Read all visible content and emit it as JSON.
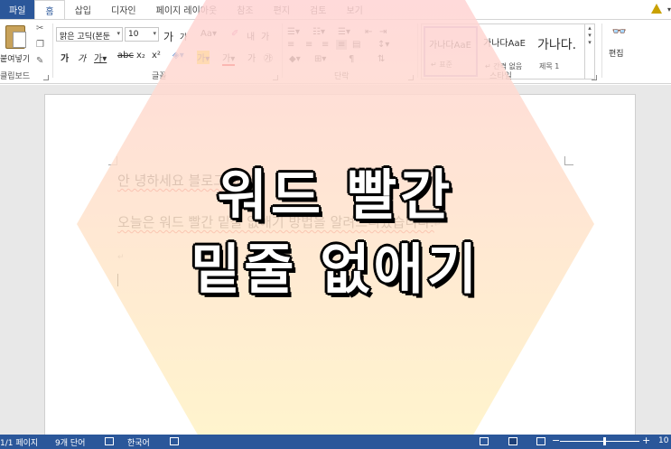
{
  "tabs": [
    {
      "label": "파일"
    },
    {
      "label": "홈"
    },
    {
      "label": "삽입"
    },
    {
      "label": "디자인"
    },
    {
      "label": "페이지 레이아웃"
    },
    {
      "label": "참조"
    },
    {
      "label": "편지"
    },
    {
      "label": "검토"
    },
    {
      "label": "보기"
    }
  ],
  "ribbon": {
    "clipboard": {
      "paste_label": "붙여넣기",
      "group_label": "클립보드"
    },
    "font": {
      "font_name": "맑은 고딕(본둔",
      "font_size": "10",
      "group_label": "글꼴"
    },
    "paragraph": {
      "group_label": "단락"
    },
    "styles": {
      "group_label": "스타일",
      "cards": [
        {
          "sample": "가나다AaE",
          "name": "↵ 표준"
        },
        {
          "sample": "가나다AaE",
          "name": "↵ 간격 없음"
        },
        {
          "sample": "가나다.",
          "name": "제목 1"
        }
      ]
    },
    "editing": {
      "label": "편집"
    }
  },
  "document": {
    "line1": "안 녕하세요 블로그 에요",
    "line2": "오늘은 워드 빨간 밑줄 없애기 방법을 알려드리겠습니다."
  },
  "overlay": {
    "title_line1": "워드 빨간",
    "title_line2": "밑줄 없애기",
    "hex_colors": {
      "top": "#ffd3d3",
      "bottom": "#fff3c4"
    }
  },
  "statusbar": {
    "page": "1/1 페이지",
    "words": "9개 단어",
    "language": "한국어",
    "zoom": "10"
  }
}
